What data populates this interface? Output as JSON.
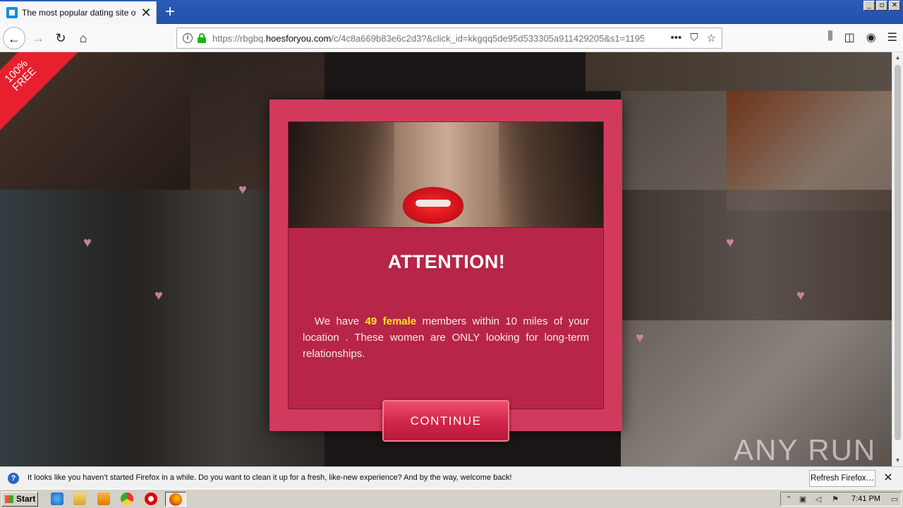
{
  "browser": {
    "tab_title": "The most popular dating site of th",
    "tab_close": "✕",
    "new_tab": "+",
    "url_prefix": "https://rbgbq.",
    "url_domain": "hoesforyou.com",
    "url_rest": "/c/4c8a669b83e6c2d3?&click_id=kkgqq5de95d533305a911429205&s1=1195",
    "url_more": "•••",
    "window_buttons": [
      "_",
      "▫",
      "✕"
    ]
  },
  "page": {
    "ribbon": "100%\nFREE",
    "modal_title": "ATTENTION!",
    "msg_before": "We have ",
    "msg_count": "49 female",
    "msg_after": " members within 10 miles of your location . These women are ONLY looking for long-term relationships.",
    "cta_label": "CONTINUE",
    "watermark": "ANY RUN"
  },
  "notification": {
    "text": "It looks like you haven’t started Firefox in a while. Do you want to clean it up for a fresh, like-new experience? And by the way, welcome back!",
    "button": "Refresh Firefox…",
    "close": "✕"
  },
  "taskbar": {
    "start": "Start",
    "clock": "7:41 PM"
  },
  "colors": {
    "modal_bg": "#d13a5c",
    "highlight": "#ffe51e",
    "ribbon": "#e8202e"
  }
}
